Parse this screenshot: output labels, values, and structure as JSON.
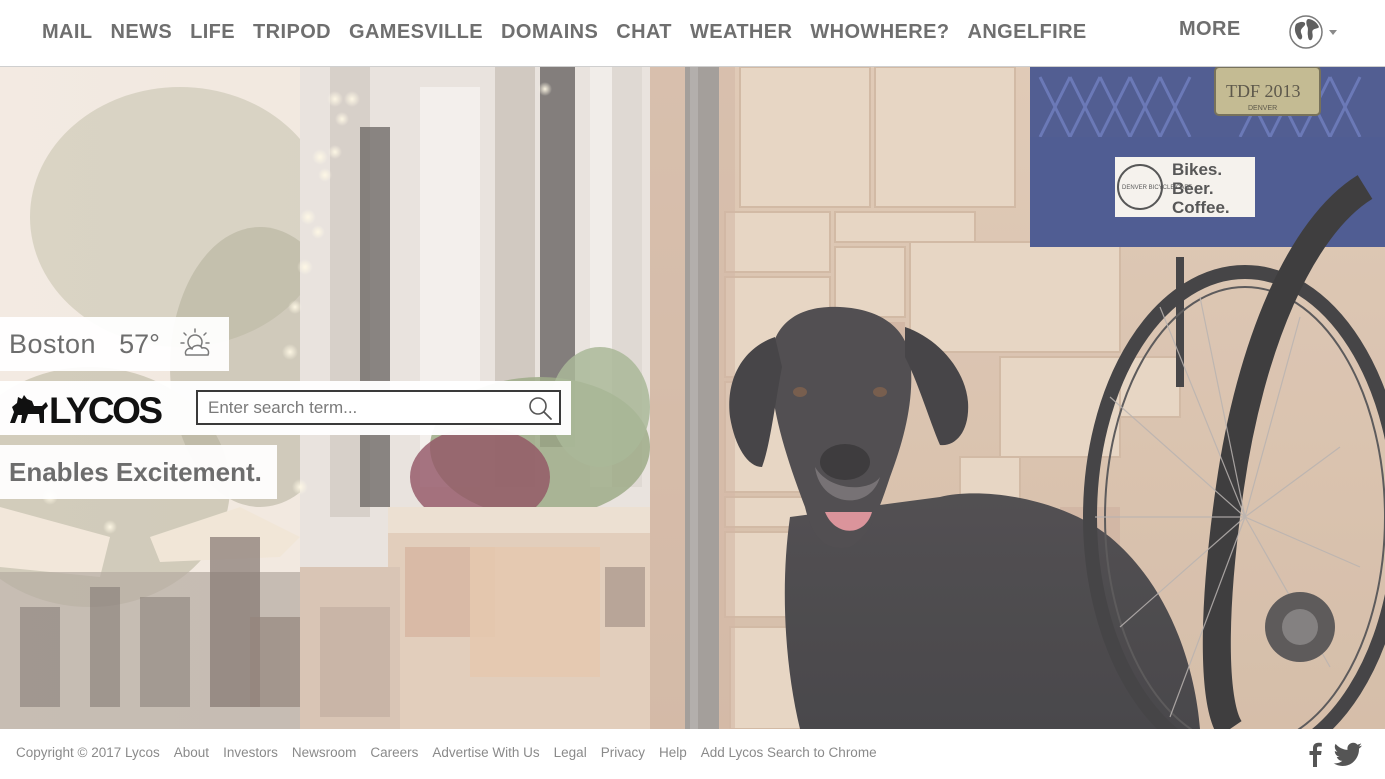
{
  "nav": {
    "items": [
      {
        "label": "MAIL"
      },
      {
        "label": "NEWS"
      },
      {
        "label": "LIFE"
      },
      {
        "label": "TRIPOD"
      },
      {
        "label": "GAMESVILLE"
      },
      {
        "label": "DOMAINS"
      },
      {
        "label": "CHAT"
      },
      {
        "label": "WEATHER"
      },
      {
        "label": "WHOWHERE?"
      },
      {
        "label": "ANGELFIRE"
      }
    ],
    "more_label": "MORE",
    "globe_icon": "globe-icon"
  },
  "weather": {
    "city": "Boston",
    "temperature": "57°",
    "icon": "partly-sunny-icon"
  },
  "search": {
    "placeholder": "Enter search term...",
    "value": "",
    "logo_text": "LYCOS",
    "icon": "search-icon"
  },
  "tagline": "Enables Excitement.",
  "hero": {
    "crate_sign": [
      "Bikes.",
      "Beer.",
      "Coffee."
    ],
    "plate_text": "TDF 2013",
    "plate_sub": "DENVER",
    "badge_text": "DENVER BICYCLE CAFE"
  },
  "footer": {
    "copyright": "Copyright © 2017 Lycos",
    "links": [
      {
        "label": "About"
      },
      {
        "label": "Investors"
      },
      {
        "label": "Newsroom"
      },
      {
        "label": "Careers"
      },
      {
        "label": "Advertise With Us"
      },
      {
        "label": "Legal"
      },
      {
        "label": "Privacy"
      },
      {
        "label": "Help"
      },
      {
        "label": "Add Lycos Search to Chrome"
      }
    ],
    "social": [
      "facebook-icon",
      "twitter-icon"
    ]
  },
  "colors": {
    "nav_text": "#6f6f6f",
    "footer_text": "#8a8a8a",
    "search_border": "#3a3a3a"
  }
}
